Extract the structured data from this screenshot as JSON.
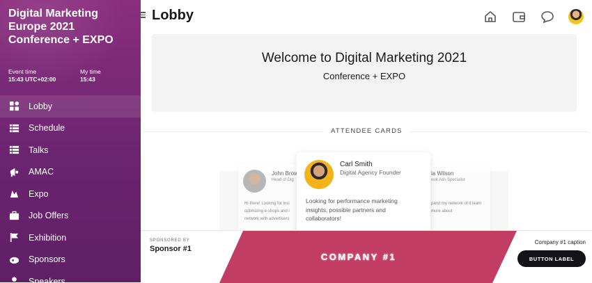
{
  "event": {
    "title": "Digital Marketing Europe 2021 Conference + EXPO",
    "event_time_label": "Event time",
    "event_time_value": "15:43 UTC+02:00",
    "my_time_label": "My time",
    "my_time_value": "15:43"
  },
  "sidebar": {
    "items": [
      {
        "label": "Lobby",
        "icon": "lobby-icon",
        "active": true
      },
      {
        "label": "Schedule",
        "icon": "schedule-icon"
      },
      {
        "label": "Talks",
        "icon": "talks-icon"
      },
      {
        "label": "AMAC",
        "icon": "megaphone-icon"
      },
      {
        "label": "Expo",
        "icon": "expo-icon"
      },
      {
        "label": "Job Offers",
        "icon": "briefcase-icon"
      },
      {
        "label": "Exhibition",
        "icon": "flag-icon"
      },
      {
        "label": "Sponsors",
        "icon": "sponsors-icon"
      },
      {
        "label": "Speakers",
        "icon": "speakers-icon"
      }
    ]
  },
  "header": {
    "title": "Lobby",
    "icons": [
      "home-icon",
      "wallet-icon",
      "chat-icon",
      "user-avatar"
    ]
  },
  "welcome": {
    "title": "Welcome to Digital Marketing 2021",
    "subtitle": "Conference + EXPO"
  },
  "attendees": {
    "section_title": "ATTENDEE CARDS",
    "cards": [
      {
        "name": "John Brow",
        "role": "Head of Dig",
        "bio": "Hi there! Looking for insi optimizing e-shops and i network with advertisers"
      },
      {
        "name": "Carl Smith",
        "role": "Digital Agency Founder",
        "bio": "Looking for performance marketing insights, possible partners and collaborators!"
      },
      {
        "name": "ia Wilson",
        "role": "ook Ads Specialist",
        "bio": "pand my network of d learn more about"
      }
    ]
  },
  "sponsor": {
    "sponsored_by_label": "SPONSORED BY",
    "name": "Sponsor #1",
    "banner_text": "COMPANY #1",
    "caption": "Company #1 caption",
    "button_label": "BUTTON LABEL",
    "banner_color": "#c13d63"
  }
}
